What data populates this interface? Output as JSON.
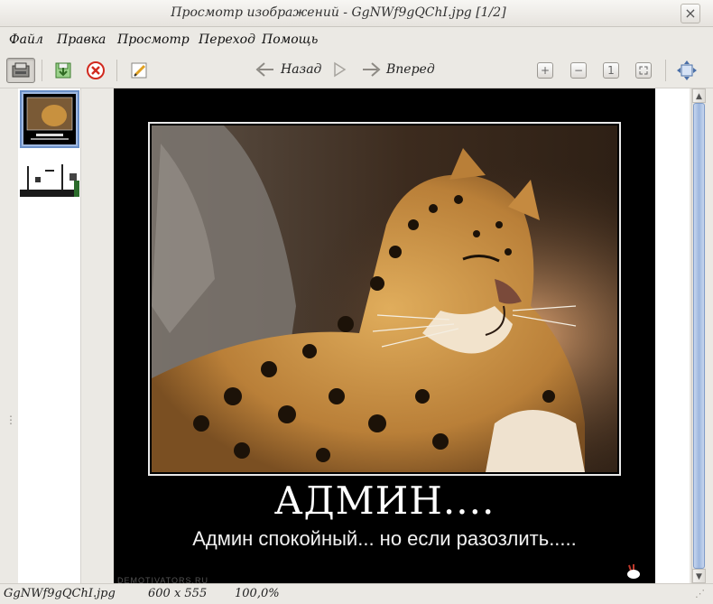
{
  "window": {
    "title": "Просмотр изображений - GgNWf9gQChI.jpg [1/2]",
    "close_glyph": "×"
  },
  "menu": [
    "Файл",
    "Правка",
    "Просмотр",
    "Переход",
    "Помощь"
  ],
  "toolbar": {
    "back_label": "Назад",
    "forward_label": "Вперед",
    "zoom_in_glyph": "+",
    "zoom_out_glyph": "−",
    "normal_size_glyph": "1"
  },
  "image": {
    "headline": "АДМИН....",
    "caption": "Админ спокойный... но если разозлить.....",
    "watermark": "DEMOTIVATORS.RU"
  },
  "status": {
    "filename": "GgNWf9gQChI.jpg",
    "dimensions": "600 x 555",
    "zoom": "100,0%"
  },
  "colors": {
    "selection": "#6a8fc7",
    "scrollbar": "#9db6de"
  }
}
